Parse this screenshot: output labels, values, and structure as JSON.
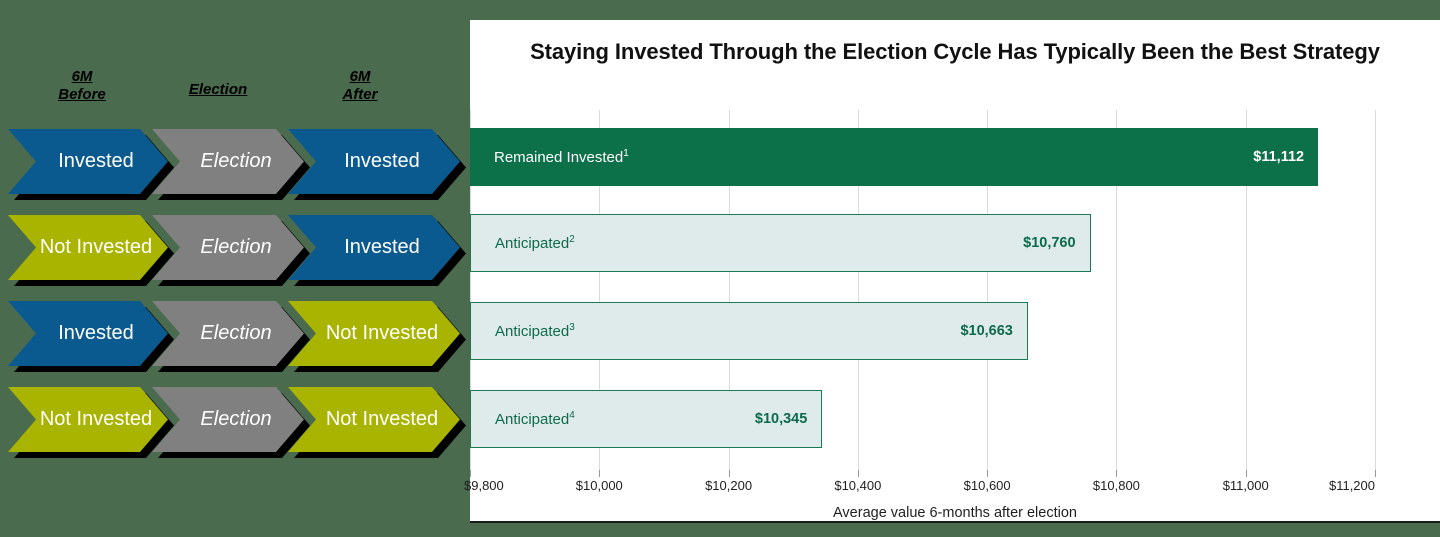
{
  "theme": {
    "page_background": "#4a6b4d",
    "card_background": "#ffffff",
    "invested_color": "#0b5a8f",
    "not_invested_color": "#a9b400",
    "election_color": "#808080",
    "bar_solid_color": "#0c7048",
    "bar_outline_fill": "#dfeaea",
    "bar_outline_border": "#1a7a52"
  },
  "flow": {
    "headers": [
      {
        "line1": "6M",
        "line2": "Before"
      },
      {
        "line1": "Election",
        "line2": ""
      },
      {
        "line1": "6M",
        "line2": "After"
      }
    ],
    "rows": [
      {
        "before": {
          "label": "Invested",
          "state": "invested"
        },
        "election": {
          "label": "Election",
          "state": "election"
        },
        "after": {
          "label": "Invested",
          "state": "invested"
        }
      },
      {
        "before": {
          "label": "Not Invested",
          "state": "not-invested"
        },
        "election": {
          "label": "Election",
          "state": "election"
        },
        "after": {
          "label": "Invested",
          "state": "invested"
        }
      },
      {
        "before": {
          "label": "Invested",
          "state": "invested"
        },
        "election": {
          "label": "Election",
          "state": "election"
        },
        "after": {
          "label": "Not Invested",
          "state": "not-invested"
        }
      },
      {
        "before": {
          "label": "Not Invested",
          "state": "not-invested"
        },
        "election": {
          "label": "Election",
          "state": "election"
        },
        "after": {
          "label": "Not Invested",
          "state": "not-invested"
        }
      }
    ]
  },
  "chart_card": {
    "title": "Staying Invested Through the Election Cycle Has Typically Been the Best Strategy"
  },
  "chart_data": {
    "type": "bar",
    "orientation": "horizontal",
    "title": "Staying Invested Through the Election Cycle Has Typically Been the Best Strategy",
    "xlabel": "Average value 6-months after election",
    "ylabel": "",
    "xlim": [
      9800,
      11200
    ],
    "xticks": [
      9800,
      10000,
      10200,
      10400,
      10600,
      10800,
      11000,
      11200
    ],
    "xtick_labels": [
      "$9,800",
      "$10,000",
      "$10,200",
      "$10,400",
      "$10,600",
      "$10,800",
      "$11,000",
      "$11,200"
    ],
    "grid": "vertical",
    "legend": "none",
    "categories": [
      "Remained Invested",
      "Anticipated",
      "Anticipated",
      "Anticipated"
    ],
    "values": [
      11112,
      10760,
      10663,
      10345
    ],
    "bars": [
      {
        "label": "Remained Invested",
        "footnote": "1",
        "value": 11112,
        "value_label": "$11,112",
        "style": "solid"
      },
      {
        "label": "Anticipated",
        "footnote": "2",
        "value": 10760,
        "value_label": "$10,760",
        "style": "outline"
      },
      {
        "label": "Anticipated",
        "footnote": "3",
        "value": 10663,
        "value_label": "$10,663",
        "style": "outline"
      },
      {
        "label": "Anticipated",
        "footnote": "4",
        "value": 10345,
        "value_label": "$10,345",
        "style": "outline"
      }
    ]
  }
}
